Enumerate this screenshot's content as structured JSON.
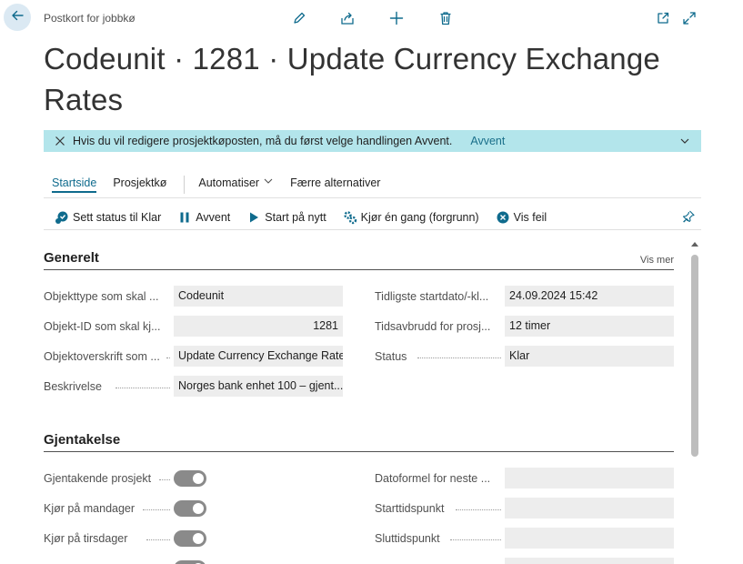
{
  "breadcrumb": "Postkort for jobbkø",
  "title": "Codeunit · 1281 · Update Currency Exchange Rates",
  "banner": {
    "message": "Hvis du vil redigere prosjektkøposten, må du først velge handlingen Avvent.",
    "action": "Avvent"
  },
  "tabs": {
    "home": "Startside",
    "queue": "Prosjektkø",
    "automate": "Automatiser",
    "fewer": "Færre alternativer"
  },
  "actions": {
    "set_ready": "Sett status til Klar",
    "hold": "Avvent",
    "restart": "Start på nytt",
    "run_once": "Kjør én gang (forgrunn)",
    "show_error": "Vis feil"
  },
  "general": {
    "title": "Generelt",
    "show_more": "Vis mer",
    "object_type_label": "Objekttype som skal ...",
    "object_type_value": "Codeunit",
    "object_id_label": "Objekt-ID som skal kj...",
    "object_id_value": "1281",
    "object_caption_label": "Objektoverskrift som ...",
    "object_caption_value": "Update Currency Exchange Rates",
    "description_label": "Beskrivelse",
    "description_value": "Norges bank enhet 100 – gjent...",
    "earliest_start_label": "Tidligste startdato/-kl...",
    "earliest_start_value": "24.09.2024 15:42",
    "timeout_label": "Tidsavbrudd for prosj...",
    "timeout_value": "12 timer",
    "status_label": "Status",
    "status_value": "Klar"
  },
  "recurrence": {
    "title": "Gjentakelse",
    "recurring_label": "Gjentakende prosjekt",
    "monday_label": "Kjør på mandager",
    "tuesday_label": "Kjør på tirsdager",
    "date_formula_label": "Datoformel for neste ...",
    "start_time_label": "Starttidspunkt",
    "end_time_label": "Sluttidspunkt"
  }
}
